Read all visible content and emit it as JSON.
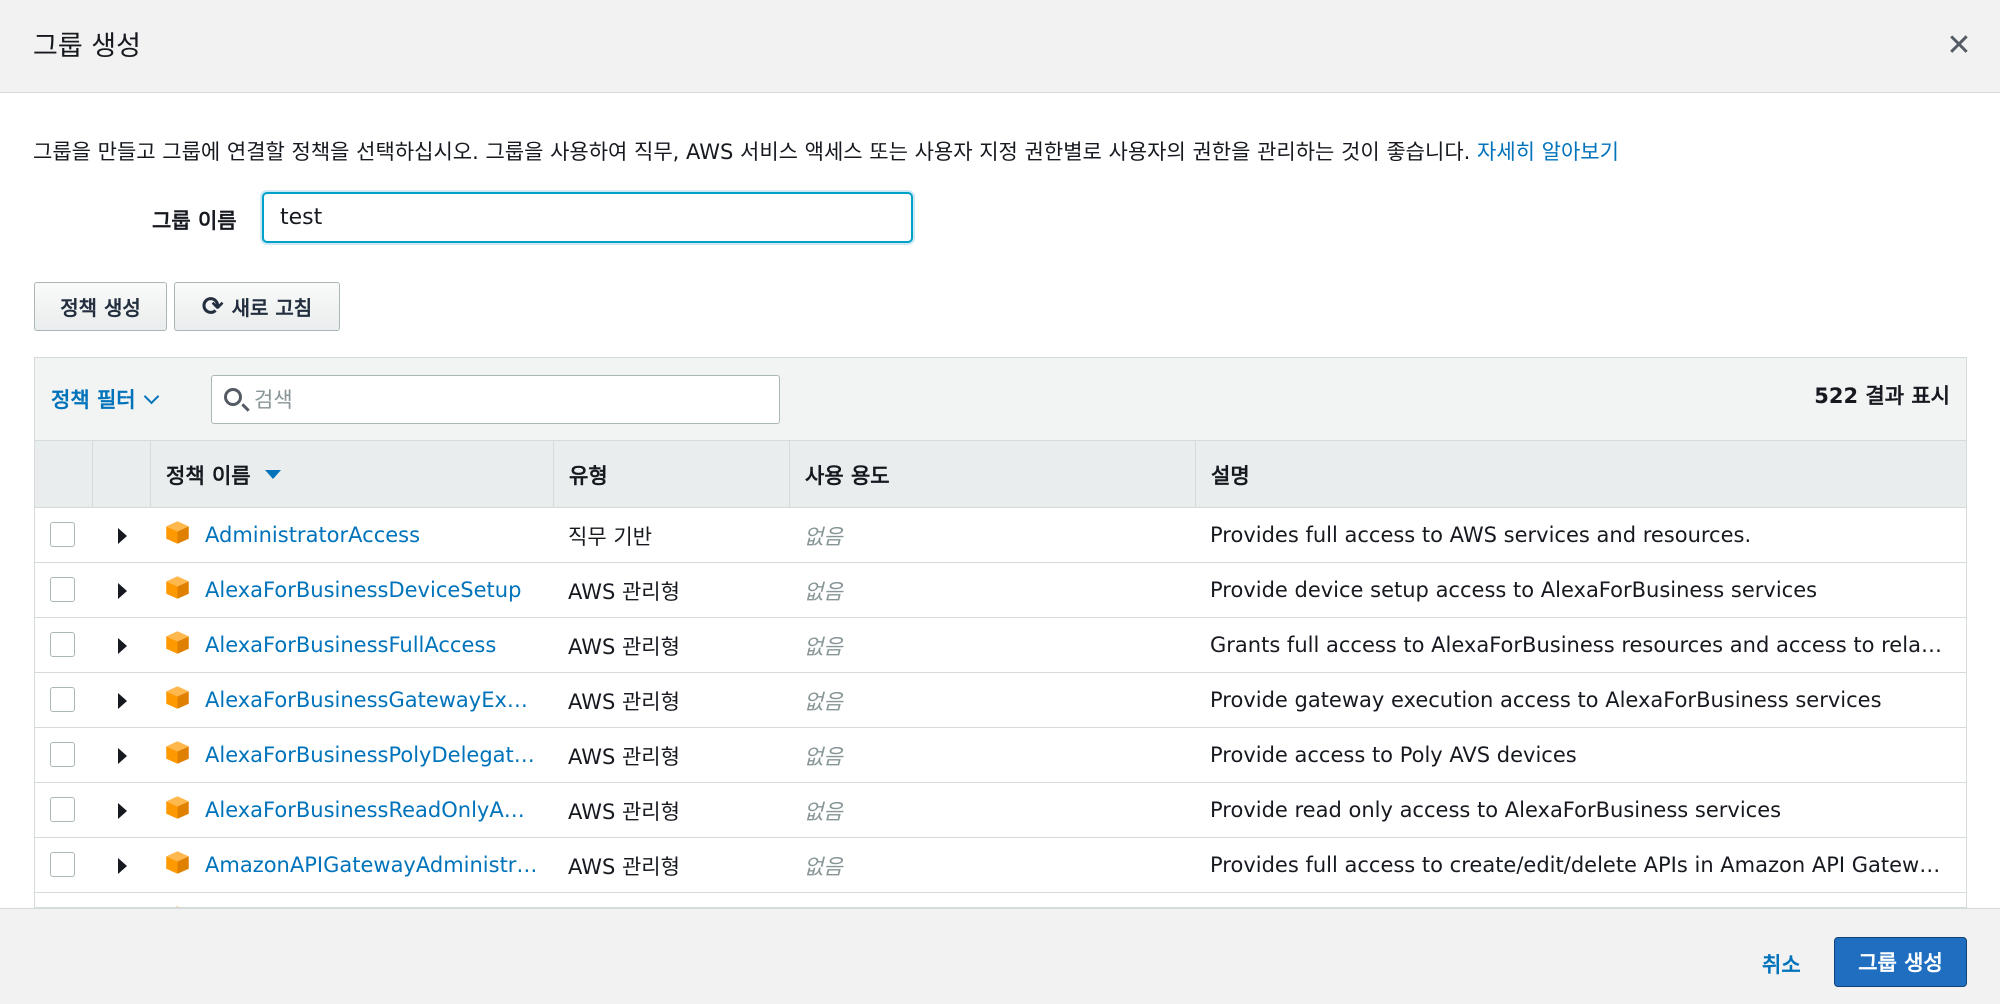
{
  "dialog": {
    "title": "그룹 생성",
    "close_icon": "close-icon",
    "intro_text": "그룹을 만들고 그룹에 연결할 정책을 선택하십시오. 그룹을 사용하여 직무, AWS 서비스 액세스 또는 사용자 지정 권한별로 사용자의 권한을 관리하는 것이 좋습니다.",
    "learn_more_link": "자세히 알아보기"
  },
  "group_name": {
    "label": "그룹 이름",
    "value": "test"
  },
  "actions": {
    "create_policy": "정책 생성",
    "refresh": "새로 고침",
    "refresh_icon": "refresh-icon"
  },
  "filter": {
    "label": "정책 필터",
    "search_placeholder": "검색",
    "result_count": "522 결과 표시"
  },
  "table": {
    "columns": {
      "name": "정책 이름",
      "type": "유형",
      "usage": "사용 용도",
      "description": "설명"
    },
    "rows": [
      {
        "name": "AdministratorAccess",
        "type": "직무 기반",
        "usage": "없음",
        "description": "Provides full access to AWS services and resources."
      },
      {
        "name": "AlexaForBusinessDeviceSetup",
        "type": "AWS 관리형",
        "usage": "없음",
        "description": "Provide device setup access to AlexaForBusiness services"
      },
      {
        "name": "AlexaForBusinessFullAccess",
        "type": "AWS 관리형",
        "usage": "없음",
        "description": "Grants full access to AlexaForBusiness resources and access to relate…"
      },
      {
        "name": "AlexaForBusinessGatewayEx…",
        "type": "AWS 관리형",
        "usage": "없음",
        "description": "Provide gateway execution access to AlexaForBusiness services"
      },
      {
        "name": "AlexaForBusinessPolyDelegat…",
        "type": "AWS 관리형",
        "usage": "없음",
        "description": "Provide access to Poly AVS devices"
      },
      {
        "name": "AlexaForBusinessReadOnlyA…",
        "type": "AWS 관리형",
        "usage": "없음",
        "description": "Provide read only access to AlexaForBusiness services"
      },
      {
        "name": "AmazonAPIGatewayAdministr…",
        "type": "AWS 관리형",
        "usage": "없음",
        "description": "Provides full access to create/edit/delete APIs in Amazon API Gatewa…"
      }
    ]
  },
  "footer": {
    "cancel": "취소",
    "create_group": "그룹 생성"
  },
  "colors": {
    "link": "#0073bb",
    "primary_button": "#1f6ec0",
    "policy_icon": "#f90"
  }
}
